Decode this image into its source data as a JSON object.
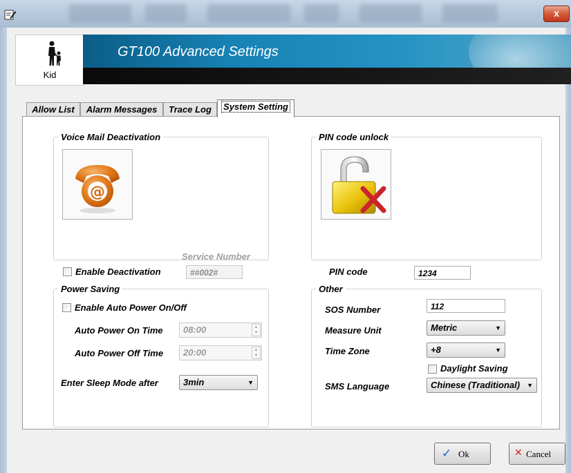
{
  "window": {
    "close_glyph": "x",
    "app_icon": "pencil-edit-icon"
  },
  "header": {
    "profile_label": "Kid",
    "title": "GT100 Advanced Settings"
  },
  "tabs": [
    {
      "label": "Allow List",
      "active": false
    },
    {
      "label": "Alarm Messages",
      "active": false
    },
    {
      "label": "Trace Log",
      "active": false
    },
    {
      "label": "System Setting",
      "active": true
    }
  ],
  "voice_mail": {
    "legend": "Voice Mail Deactivation",
    "icon": "phone-at-icon",
    "service_number_label": "Service Number",
    "service_number_value": "##002#",
    "enable_label": "Enable Deactivation",
    "enabled": false
  },
  "pin": {
    "legend": "PIN code unlock",
    "icon": "unlocked-padlock-icon",
    "code_label": "PIN code",
    "code_value": "1234"
  },
  "power": {
    "legend": "Power Saving",
    "enable_label": "Enable Auto Power On/Off",
    "enabled": false,
    "on_time_label": "Auto Power On Time",
    "on_time_value": "08:00",
    "off_time_label": "Auto Power Off Time",
    "off_time_value": "20:00",
    "sleep_label": "Enter Sleep Mode after",
    "sleep_value": "3min"
  },
  "other": {
    "legend": "Other",
    "sos_label": "SOS Number",
    "sos_value": "112",
    "measure_label": "Measure Unit",
    "measure_value": "Metric",
    "timezone_label": "Time Zone",
    "timezone_value": "+8",
    "daylight_label": "Daylight Saving",
    "daylight_enabled": false,
    "sms_label": "SMS Language",
    "sms_value": "Chinese (Traditional)"
  },
  "buttons": {
    "ok_label": "Ok",
    "cancel_label": "Cancel"
  },
  "colors": {
    "banner": "#1782b4",
    "ok_check": "#1d63c4",
    "cancel_x": "#d02020"
  }
}
